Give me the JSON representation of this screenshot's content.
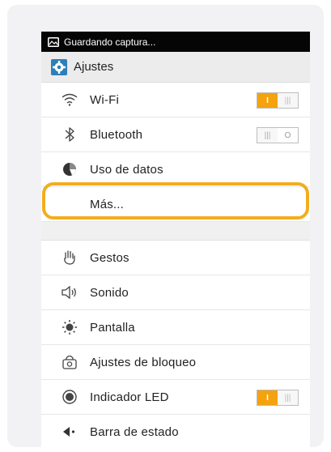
{
  "statusbar": {
    "text": "Guardando captura...",
    "icon": "screenshot-icon"
  },
  "actionbar": {
    "title": "Ajustes",
    "icon": "settings-app-icon"
  },
  "section1": [
    {
      "label": "Wi-Fi",
      "icon": "wifi-icon",
      "toggle": "on"
    },
    {
      "label": "Bluetooth",
      "icon": "bluetooth-icon",
      "toggle": "off"
    },
    {
      "label": "Uso de datos",
      "icon": "data-usage-icon"
    },
    {
      "label": "Más...",
      "icon": ""
    }
  ],
  "section2": [
    {
      "label": "Gestos",
      "icon": "gesture-hand-icon"
    },
    {
      "label": "Sonido",
      "icon": "speaker-icon"
    },
    {
      "label": "Pantalla",
      "icon": "brightness-icon"
    },
    {
      "label": "Ajustes de bloqueo",
      "icon": "lock-screen-icon"
    },
    {
      "label": "Indicador LED",
      "icon": "led-indicator-icon",
      "toggle": "on"
    },
    {
      "label": "Barra de estado",
      "icon": "status-bar-icon"
    }
  ],
  "toggle_labels": {
    "on": "I",
    "off_symbol": "O"
  },
  "colors": {
    "accent": "#f4a20e",
    "highlight": "#f2ad1e",
    "statusbar": "#050505"
  }
}
